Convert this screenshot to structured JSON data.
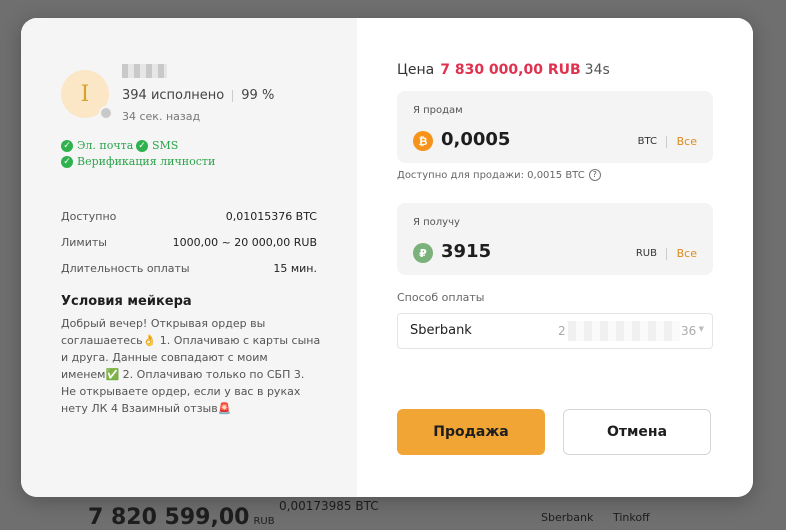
{
  "background": {
    "price": "7 820 599,00",
    "price_currency": "RUB",
    "amount": "0,00173985 BTC",
    "method_1": "Sberbank",
    "method_2": "Tinkoff"
  },
  "maker": {
    "avatar_letter": "I",
    "orders_completed": "394 исполнено",
    "completion_rate": "99 %",
    "last_seen": "34 сек. назад",
    "verifications": [
      "Эл. почта",
      "SMS",
      "Верификация личности"
    ]
  },
  "details": {
    "available_label": "Доступно",
    "available_value": "0,01015376 BTC",
    "limits_label": "Лимиты",
    "limits_value": "1000,00 ~ 20 000,00 RUB",
    "duration_label": "Длительность оплаты",
    "duration_value": "15 мин."
  },
  "conditions": {
    "title": "Условия мейкера",
    "text": "Добрый вечер! Открывая ордер вы соглашаетесь👌 1. Оплачиваю с карты сына и друга. Данные совпадают с моим именем✅ 2. Оплачиваю только по СБП 3. Не открываете ордер, если у вас в руках нету ЛК 4 Взаимный отзыв🚨"
  },
  "order": {
    "price_label": "Цена",
    "price_value": "7 830 000,00 RUB",
    "timer": "34s",
    "sell_label": "Я продам",
    "sell_amount": "0,0005",
    "sell_currency": "BTC",
    "all_label": "Все",
    "available_for_sale": "Доступно для продажи: 0,0015 BTC",
    "receive_label": "Я получу",
    "receive_amount": "3915",
    "receive_currency": "RUB",
    "payment_label": "Способ оплаты",
    "payment_bank": "Sberbank",
    "payment_account_start": "2",
    "payment_account_end": "36",
    "sell_button": "Продажа",
    "cancel_button": "Отмена"
  },
  "colors": {
    "accent": "#f0a535",
    "price": "#e0314f",
    "verified": "#2aa44a"
  }
}
